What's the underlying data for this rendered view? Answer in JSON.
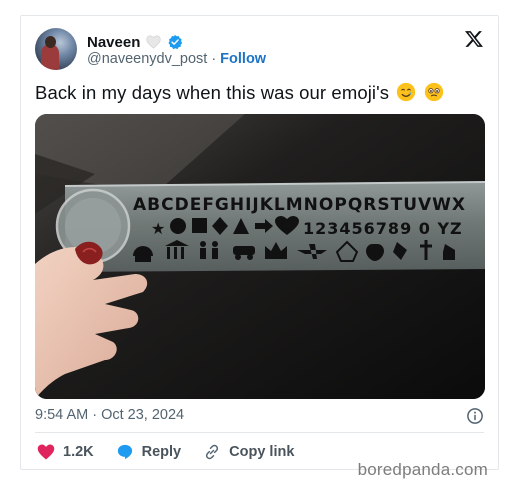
{
  "tweet": {
    "author_name": "Naveen",
    "handle": "@naveenydv_post",
    "separator": "·",
    "follow_label": "Follow",
    "text": "Back in my days when this was our emoji's",
    "timestamp": "9:54 AM · Oct 23, 2024",
    "likes_count": "1.2K",
    "reply_label": "Reply",
    "copy_link_label": "Copy link"
  },
  "media": {
    "stencil_row1": "ABCDEFGHIJKLMNOPQRSTUVWX",
    "stencil_row2": "123456789 0 YZ"
  },
  "watermark": "boredpanda.com",
  "colors": {
    "verified": "#1d9bf0",
    "follow": "#1d73c4",
    "like_heart": "#e0245e",
    "reply_bubble": "#1d9bf0",
    "muted_text": "#536471"
  },
  "icons": {
    "verified": "verified-badge-icon",
    "badge": "white-heart-icon",
    "logo": "x-logo-icon",
    "info": "info-icon",
    "like": "heart-icon",
    "reply": "reply-bubble-icon",
    "copy": "link-icon"
  }
}
